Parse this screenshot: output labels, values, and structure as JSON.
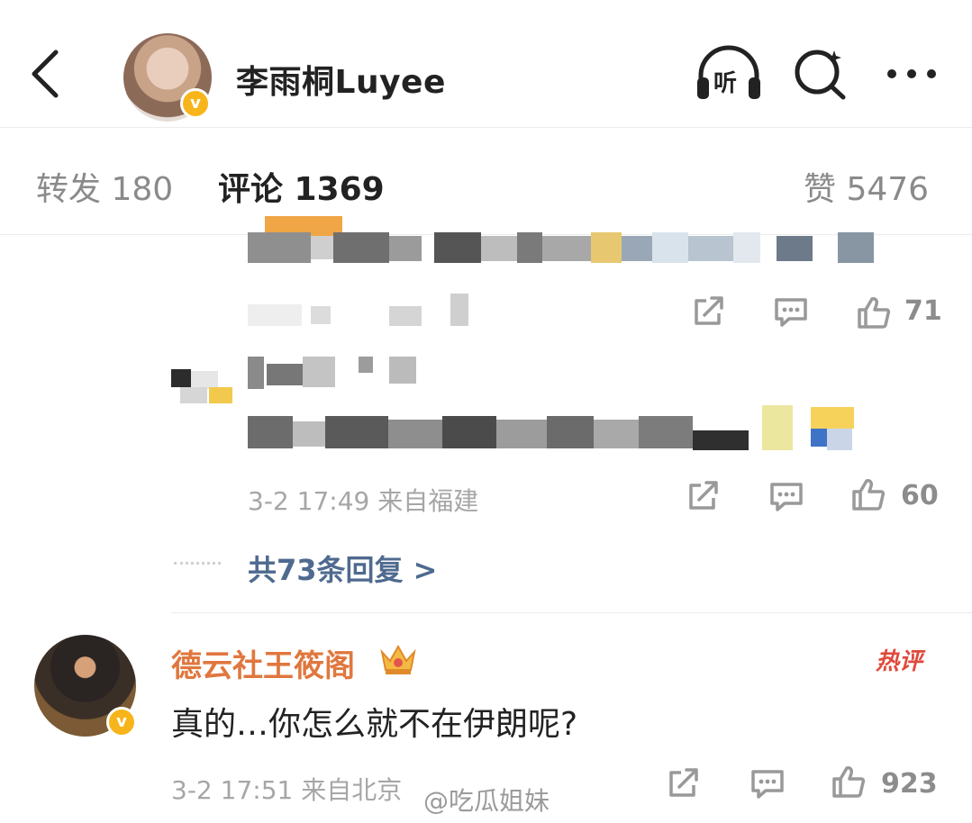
{
  "header": {
    "title": "李雨桐Luyee",
    "listen_label": "听",
    "colors": {
      "verified": "#f7b51b"
    }
  },
  "tabs": [
    {
      "label": "转发 180",
      "active": false
    },
    {
      "label": "评论 1369",
      "active": true
    },
    {
      "label": "赞 5476",
      "active": false
    }
  ],
  "reply1": {
    "like_count": "71"
  },
  "reply2": {
    "time": "3-2 17:49 来自福建",
    "like_count": "60",
    "replies_link": "共73条回复 >"
  },
  "hot_comment": {
    "username": "德云社王筱阁",
    "badge": "热评",
    "text": "真的…你怎么就不在伊朗呢?",
    "time": "3-2 17:51 来自北京",
    "like_count": "923"
  },
  "watermark": "@吃瓜姐妹"
}
